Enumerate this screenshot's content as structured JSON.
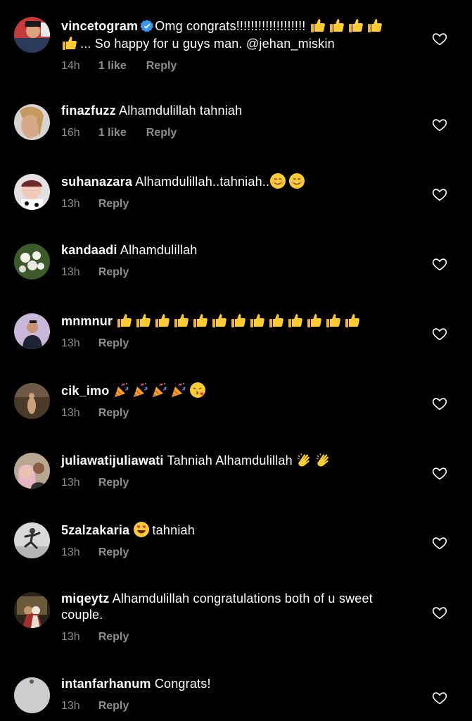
{
  "comments": [
    {
      "username": "vincetogram",
      "verified": true,
      "text_before": "Omg congrats!!!!!!!!!!!!!!!!!!! ",
      "emoji_1": [
        "thumbs-up",
        "thumbs-up",
        "thumbs-up",
        "thumbs-up",
        "thumbs-up"
      ],
      "text_after": "... So happy for u guys man. @jehan_miskin",
      "time": "14h",
      "likes": "1 like",
      "reply": "Reply"
    },
    {
      "username": "finazfuzz",
      "text": "Alhamdulillah tahniah",
      "time": "16h",
      "likes": "1 like",
      "reply": "Reply"
    },
    {
      "username": "suhanazara",
      "text": "Alhamdulillah..tahniah..",
      "emoji": [
        "smiling-face",
        "smiling-face"
      ],
      "time": "13h",
      "reply": "Reply"
    },
    {
      "username": "kandaadi",
      "text": "Alhamdulillah",
      "time": "13h",
      "reply": "Reply"
    },
    {
      "username": "mnmnur",
      "text": "",
      "emoji": [
        "thumbs-up",
        "thumbs-up",
        "thumbs-up",
        "thumbs-up",
        "thumbs-up",
        "thumbs-up",
        "thumbs-up",
        "thumbs-up",
        "thumbs-up",
        "thumbs-up",
        "thumbs-up",
        "thumbs-up",
        "thumbs-up"
      ],
      "time": "13h",
      "reply": "Reply"
    },
    {
      "username": "cik_imo",
      "text": "",
      "emoji": [
        "party-popper",
        "party-popper",
        "party-popper",
        "party-popper",
        "kissing-face"
      ],
      "time": "13h",
      "reply": "Reply"
    },
    {
      "username": "juliawatijuliawati",
      "text": "Tahniah Alhamdulillah",
      "emoji": [
        "clapping-hands",
        "clapping-hands"
      ],
      "time": "13h",
      "reply": "Reply"
    },
    {
      "username": "5zalzakaria",
      "text": "tahniah",
      "emoji_before": [
        "heart-eyes-face"
      ],
      "time": "13h",
      "reply": "Reply"
    },
    {
      "username": "miqeytz",
      "text": "Alhamdulillah congratulations both of u sweet couple.",
      "time": "13h",
      "reply": "Reply"
    },
    {
      "username": "intanfarhanum",
      "text": "Congrats!",
      "time": "13h",
      "reply": "Reply"
    }
  ],
  "colors": {
    "background": "#000000",
    "text": "#ffffff",
    "meta": "#8e8e8e",
    "verified": "#3897f0",
    "emoji_yellow": "#ffcc33"
  }
}
